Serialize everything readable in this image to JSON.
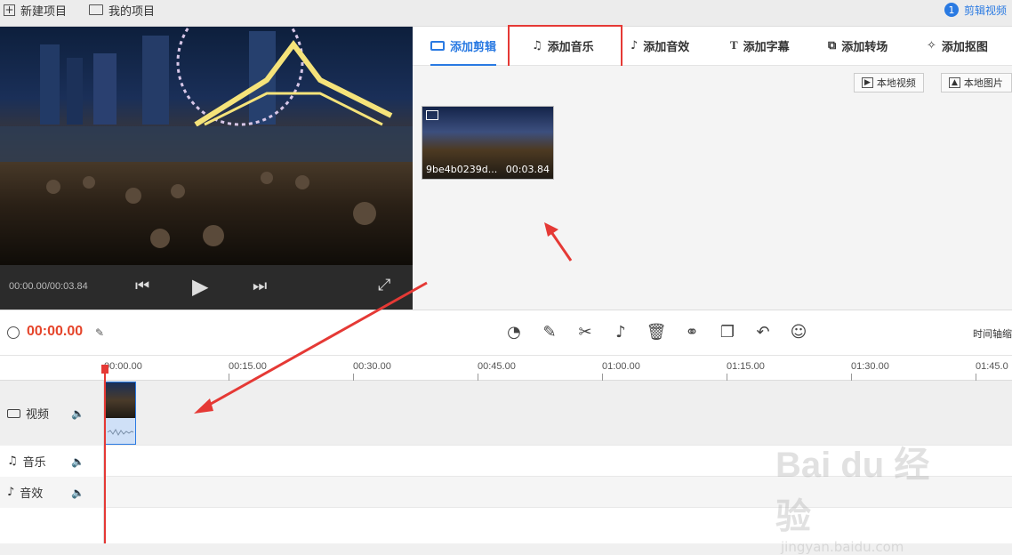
{
  "topbar": {
    "new_project": "新建项目",
    "my_projects": "我的项目",
    "step_number": "1",
    "step_label": "剪辑视频"
  },
  "player": {
    "time_display": "00:00.00/00:03.84"
  },
  "tabs": [
    {
      "label": "添加剪辑",
      "icon": "video-camera-icon",
      "active": true
    },
    {
      "label": "添加音乐",
      "icon": "music-note-icon",
      "active": false
    },
    {
      "label": "添加音效",
      "icon": "sound-effect-icon",
      "active": false
    },
    {
      "label": "添加字幕",
      "icon": "text-t-icon",
      "active": false
    },
    {
      "label": "添加转场",
      "icon": "transition-icon",
      "active": false
    },
    {
      "label": "添加抠图",
      "icon": "magic-wand-icon",
      "active": false
    }
  ],
  "media": {
    "local_video": "本地视频",
    "local_image": "本地图片",
    "clip_name": "9be4b0239d...",
    "clip_duration": "00:03.84"
  },
  "toolbar": {
    "current_time": "00:00.00",
    "zoom_label": "时间轴缩"
  },
  "ruler": {
    "ticks": [
      "00:00.00",
      "00:15.00",
      "00:30.00",
      "00:45.00",
      "01:00.00",
      "01:15.00",
      "01:30.00",
      "01:45.0"
    ]
  },
  "tracks": {
    "video": "视频",
    "music": "音乐",
    "sfx": "音效"
  },
  "watermark": {
    "brand": "Bai du 经验",
    "url": "jingyan.baidu.com"
  },
  "colors": {
    "accent": "#2a7ae2",
    "highlight": "#e53935",
    "time": "#e5452b"
  }
}
